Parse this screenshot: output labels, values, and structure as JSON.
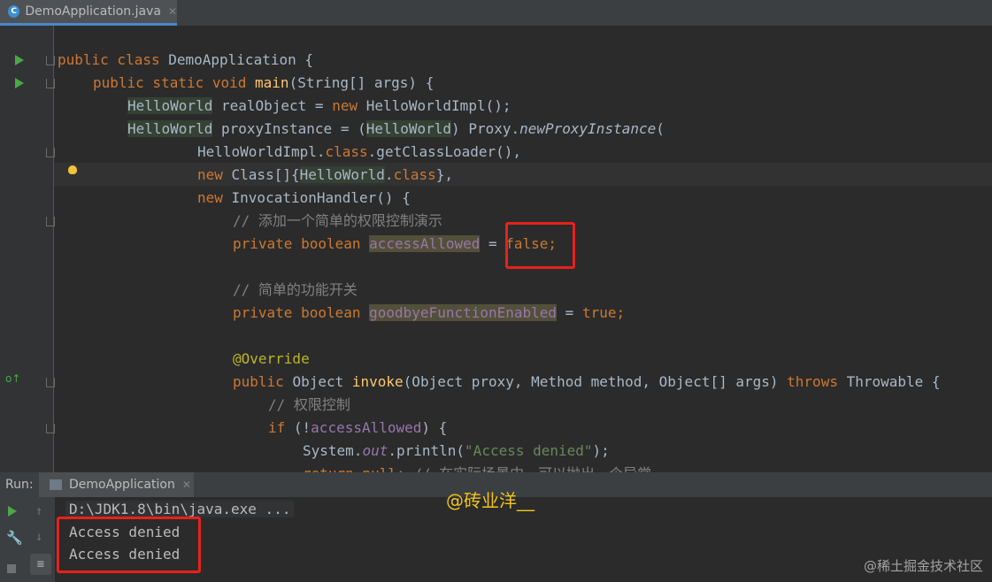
{
  "tab": {
    "title": "DemoApplication.java"
  },
  "code": {
    "l1": {
      "a": "public class ",
      "b": "DemoApplication {"
    },
    "l2": {
      "a": "public static void ",
      "b": "main",
      "c": "(String[] args) {"
    },
    "l3": {
      "a": "HelloWorld",
      "b": " realObject = ",
      "c": "new ",
      "d": "HelloWorldImpl();"
    },
    "l4": {
      "a": "HelloWorld",
      "b": " proxyInstance = (",
      "c": "HelloWorld",
      "d": ") Proxy.",
      "e": "newProxyInstance",
      "f": "("
    },
    "l5": {
      "a": "HelloWorldImpl.",
      "b": "class",
      "c": ".getClassLoader(),"
    },
    "l6": {
      "a": "new ",
      "b": "Class[]{",
      "c": "HelloWorld",
      "d": ".",
      "e": "class",
      "f": "},"
    },
    "l7": {
      "a": "new ",
      "b": "InvocationHandler() {"
    },
    "l8": "// 添加一个简单的权限控制演示",
    "l9": {
      "a": "private boolean ",
      "b": "accessAllowed",
      "c": " = ",
      "d": "false;"
    },
    "l10": "// 简单的功能开关",
    "l11": {
      "a": "private boolean ",
      "b": "goodbyeFunctionEnabled",
      "c": " = ",
      "d": "true;"
    },
    "l12": "@Override",
    "l13": {
      "a": "public ",
      "b": "Object ",
      "c": "invoke",
      "d": "(Object proxy, Method method, Object[] args) ",
      "e": "throws ",
      "f": "Throwable {"
    },
    "l14": "// 权限控制",
    "l15": {
      "a": "if ",
      "b": "(!",
      "c": "accessAllowed",
      "d": ") {"
    },
    "l16": {
      "a": "System.",
      "b": "out",
      "c": ".println(",
      "d": "\"Access denied\"",
      "e": ");"
    },
    "l17": {
      "a": "return null",
      "b": "; // 在实际场景中，可以抛出一个异常"
    }
  },
  "run": {
    "label": "Run:",
    "tab_title": "DemoApplication"
  },
  "console": {
    "cmd": "D:\\JDK1.8\\bin\\java.exe ...",
    "out1": "Access denied",
    "out2": "Access denied"
  },
  "watermark": "@砖业洋__",
  "watermark2": "@稀土掘金技术社区"
}
